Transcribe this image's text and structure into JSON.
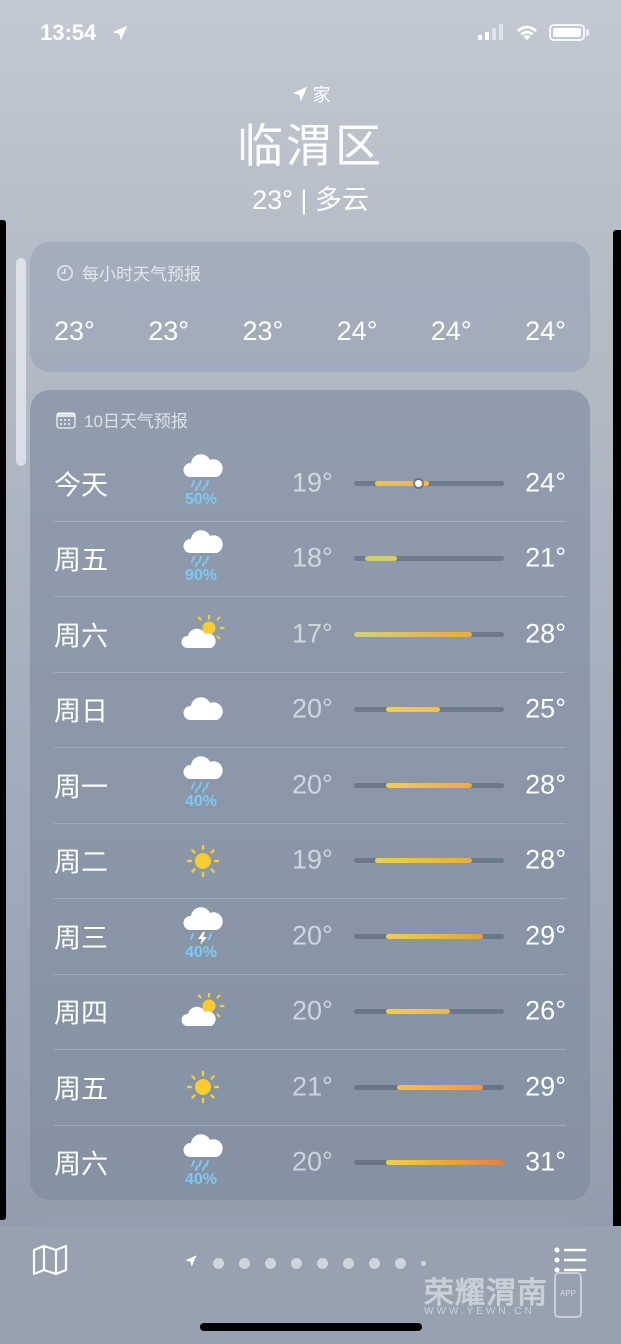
{
  "status_bar": {
    "time": "13:54"
  },
  "header": {
    "home_label": "家",
    "city": "临渭区",
    "summary": "23° | 多云"
  },
  "hourly": {
    "title": "每小时天气预报",
    "temps": [
      "23°",
      "23°",
      "23°",
      "24°",
      "24°",
      "24°"
    ]
  },
  "forecast": {
    "title": "10日天气预报",
    "range_min": 17,
    "range_max": 31,
    "days": [
      {
        "day": "今天",
        "icon": "rain-cloud-icon",
        "precip": "50%",
        "low": "19°",
        "high": "24°",
        "low_val": 19,
        "high_val": 24,
        "current": 23,
        "color_from": "#e8c84a",
        "color_to": "#f2b73a"
      },
      {
        "day": "周五",
        "icon": "rain-cloud-icon",
        "precip": "90%",
        "low": "18°",
        "high": "21°",
        "low_val": 18,
        "high_val": 21,
        "color_from": "#c9d06a",
        "color_to": "#ddcc55"
      },
      {
        "day": "周六",
        "icon": "partly-sunny-icon",
        "precip": "",
        "low": "17°",
        "high": "28°",
        "low_val": 17,
        "high_val": 28,
        "color_from": "#cfd27a",
        "color_to": "#f0a93a"
      },
      {
        "day": "周日",
        "icon": "cloud-icon",
        "precip": "",
        "low": "20°",
        "high": "25°",
        "low_val": 20,
        "high_val": 25,
        "color_from": "#f0d04a",
        "color_to": "#f2c040"
      },
      {
        "day": "周一",
        "icon": "rain-cloud-icon",
        "precip": "40%",
        "low": "20°",
        "high": "28°",
        "low_val": 20,
        "high_val": 28,
        "color_from": "#f0d04a",
        "color_to": "#f0a93a"
      },
      {
        "day": "周二",
        "icon": "sun-icon",
        "precip": "",
        "low": "19°",
        "high": "28°",
        "low_val": 19,
        "high_val": 28,
        "color_from": "#ead24c",
        "color_to": "#f0a93a"
      },
      {
        "day": "周三",
        "icon": "thunderstorm-icon",
        "precip": "40%",
        "low": "20°",
        "high": "29°",
        "low_val": 20,
        "high_val": 29,
        "color_from": "#f0d04a",
        "color_to": "#f09a38"
      },
      {
        "day": "周四",
        "icon": "partly-sunny-icon",
        "precip": "",
        "low": "20°",
        "high": "26°",
        "low_val": 20,
        "high_val": 26,
        "color_from": "#f0d04a",
        "color_to": "#f0b83a"
      },
      {
        "day": "周五",
        "icon": "sun-icon",
        "precip": "",
        "low": "21°",
        "high": "29°",
        "low_val": 21,
        "high_val": 29,
        "color_from": "#f2c440",
        "color_to": "#f09a38"
      },
      {
        "day": "周六",
        "icon": "rain-cloud-icon",
        "precip": "40%",
        "low": "20°",
        "high": "31°",
        "low_val": 20,
        "high_val": 31,
        "color_from": "#f0d04a",
        "color_to": "#ee7e34"
      }
    ]
  },
  "bottom_bar": {
    "page_count": 9,
    "watermark": "荣耀渭南",
    "watermark_sub": "WWW.YEWN.CN",
    "watermark_app": "APP"
  }
}
